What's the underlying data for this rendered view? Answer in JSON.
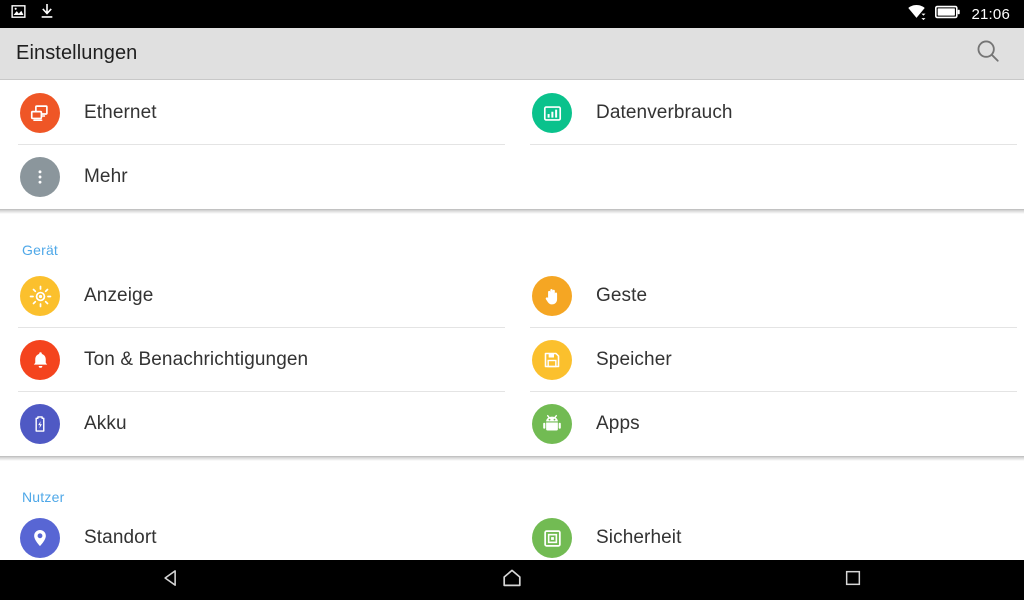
{
  "status_bar": {
    "left_icons": [
      {
        "name": "screenshot-image-icon",
        "glyph": "image"
      },
      {
        "name": "download-icon",
        "glyph": "download"
      }
    ],
    "right_icons": [
      {
        "name": "wifi-icon",
        "glyph": "wifi"
      },
      {
        "name": "battery-icon",
        "glyph": "battery-full"
      }
    ],
    "clock": "21:06"
  },
  "action_bar": {
    "title": "Einstellungen",
    "search_icon": "search-icon"
  },
  "sections": [
    {
      "id": "wireless",
      "header": null,
      "rows": [
        [
          {
            "label": "Ethernet",
            "icon": "ethernet-icon",
            "color": "#ef5626",
            "divider": true
          },
          {
            "label": "Datenverbrauch",
            "icon": "data-usage-icon",
            "color": "#0ac28c",
            "divider": true
          }
        ],
        [
          {
            "label": "Mehr",
            "icon": "more-overflow-icon",
            "color": "#8b969c",
            "divider": false
          },
          {
            "label": "",
            "icon": null,
            "color": null,
            "divider": false
          }
        ]
      ]
    },
    {
      "id": "device",
      "header": "Gerät",
      "rows": [
        [
          {
            "label": "Anzeige",
            "icon": "brightness-icon",
            "color": "#fbc02d",
            "divider": true
          },
          {
            "label": "Geste",
            "icon": "hand-gesture-icon",
            "color": "#f5a623",
            "divider": true
          }
        ],
        [
          {
            "label": "Ton & Benachrichtigungen",
            "icon": "bell-icon",
            "color": "#f4441e",
            "divider": true
          },
          {
            "label": "Speicher",
            "icon": "storage-save-icon",
            "color": "#fbc02d",
            "divider": true
          }
        ],
        [
          {
            "label": "Akku",
            "icon": "battery-charging-icon",
            "color": "#4f59c4",
            "divider": false
          },
          {
            "label": "Apps",
            "icon": "android-apps-icon",
            "color": "#72bb53",
            "divider": false
          }
        ]
      ]
    },
    {
      "id": "user",
      "header": "Nutzer",
      "rows": [
        [
          {
            "label": "Standort",
            "icon": "location-pin-icon",
            "color": "#5866d4",
            "divider": false
          },
          {
            "label": "Sicherheit",
            "icon": "security-icon",
            "color": "#72bb53",
            "divider": false
          }
        ]
      ]
    }
  ],
  "nav_bar": {
    "buttons": [
      {
        "name": "nav-back-button",
        "glyph": "triangle-left"
      },
      {
        "name": "nav-home-button",
        "glyph": "home-pentagon"
      },
      {
        "name": "nav-recents-button",
        "glyph": "square"
      }
    ]
  },
  "colors": {
    "action_bar_bg": "#e0e0e0",
    "section_header": "#4fa8e8",
    "list_bg": "#ffffff",
    "label": "#333333",
    "divider": "#e4e4e4",
    "system_bar": "#000000"
  }
}
